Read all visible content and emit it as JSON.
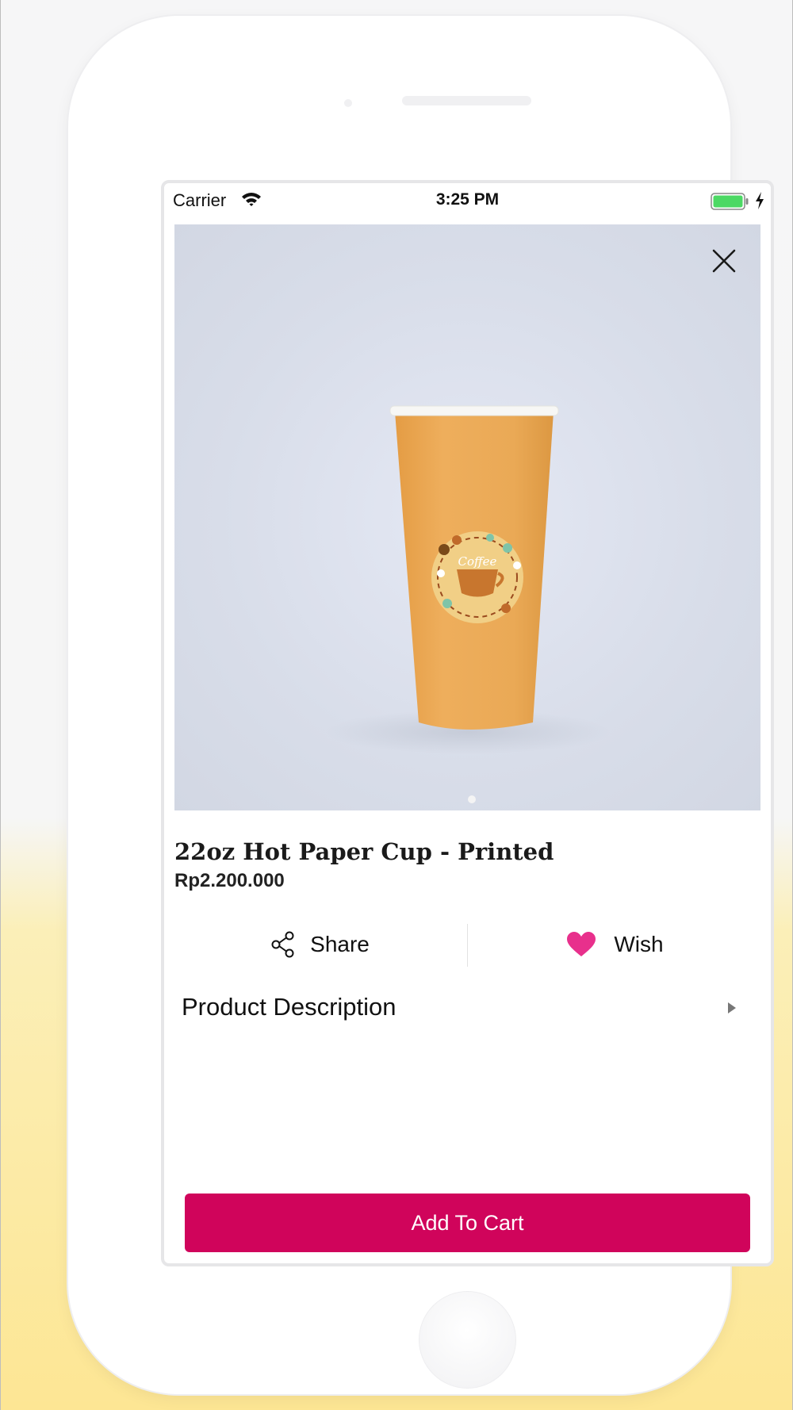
{
  "status_bar": {
    "carrier": "Carrier",
    "time": "3:25 PM",
    "wifi_icon": "wifi-icon",
    "battery_icon": "battery-icon",
    "charging_icon": "bolt-icon",
    "battery_color": "#4cd964"
  },
  "hero": {
    "cup_print_text": "Coffee",
    "close_icon": "close-icon",
    "background_color": "#dde1ed",
    "cup_color": "#eaa956"
  },
  "product": {
    "title": "22oz Hot Paper Cup - Printed",
    "price": "Rp2.200.000"
  },
  "actions": {
    "share_label": "Share",
    "share_icon": "share-icon",
    "wish_label": "Wish",
    "wish_icon": "heart-icon",
    "heart_color": "#e8308c"
  },
  "description": {
    "label": "Product Description",
    "arrow_icon": "triangle-right-icon"
  },
  "cart": {
    "label": "Add To Cart",
    "color": "#d0045b"
  }
}
